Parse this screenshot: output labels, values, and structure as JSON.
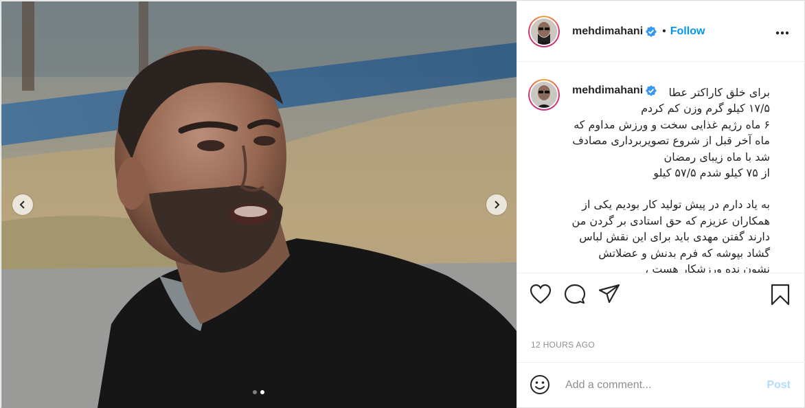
{
  "post": {
    "username": "mehdimahani",
    "follow_label": "Follow",
    "separator": "•",
    "timestamp": "12 HOURS AGO",
    "carousel": {
      "slide_count": 2,
      "active_index": 1
    }
  },
  "caption": {
    "username": "mehdimahani",
    "lines": [
      "برای خلق کاراکتر عطا",
      "۱۷/۵ کیلو گرم وزن کم کردم",
      "۶ ماه رژیم غذایی سخت و ورزش مداوم که",
      "ماه آخر قبل از شروع تصویربرداری مصادف",
      "شد با ماه زیبای رمضان",
      "از ۷۵ کیلو شدم ۵۷/۵ کیلو",
      "",
      "به یاد دارم در پیش تولید کار بودیم یکی از",
      "همکاران عزیزم که حق استادی بر گردن من",
      "دارند گفتن مهدی باید برای این نقش لباس",
      "گشاد بپوشه که فرم بدنش و عضلاتش",
      "نشون نده ورزشکار هست ،"
    ]
  },
  "comment": {
    "placeholder": "Add a comment...",
    "post_label": "Post"
  },
  "colors": {
    "link_blue": "#0095f6",
    "post_disabled": "#b3dbff",
    "muted": "#8e8e8e",
    "verified": "#3897f0"
  },
  "icons": {
    "like": "heart-icon",
    "comment": "comment-bubble-icon",
    "share": "paper-plane-icon",
    "save": "bookmark-icon",
    "emoji": "smiley-icon",
    "more": "ellipsis-icon",
    "prev": "chevron-left-icon",
    "next": "chevron-right-icon",
    "verified": "verified-badge-icon"
  }
}
